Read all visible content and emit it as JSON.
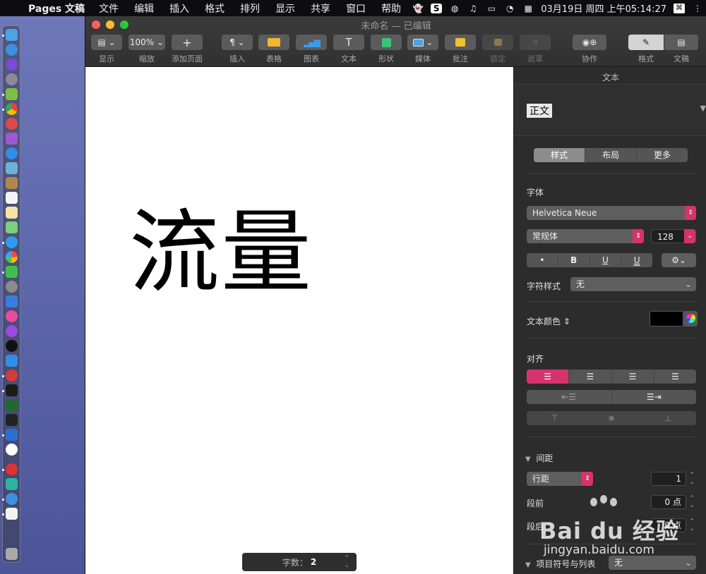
{
  "menubar": {
    "app_name": "Pages 文稿",
    "items": [
      "文件",
      "编辑",
      "插入",
      "格式",
      "排列",
      "显示",
      "共享",
      "窗口",
      "帮助"
    ],
    "datetime": "03月19日 周四 上午05:14:27"
  },
  "window": {
    "title": "未命名 — 已编辑"
  },
  "toolbar": {
    "view_label": "显示",
    "zoom_value": "100%",
    "zoom_label": "缩放",
    "add_page_label": "添加页面",
    "insert_label": "插入",
    "table_label": "表格",
    "chart_label": "图表",
    "text_label": "文本",
    "shape_label": "形状",
    "media_label": "媒体",
    "comment_label": "批注",
    "lock_label": "锁定",
    "mask_label": "遮罩",
    "collaborate_label": "协作",
    "format_label": "格式",
    "document_label": "文稿"
  },
  "document": {
    "body_text": "流量",
    "word_count_label": "字数：",
    "word_count": "2"
  },
  "inspector": {
    "header": "文本",
    "paragraph_style": "正文",
    "tabs": [
      "样式",
      "布局",
      "更多"
    ],
    "font_section": "字体",
    "font_family": "Helvetica Neue",
    "font_typeface": "常规体",
    "font_size": "128",
    "char_style_label": "字符样式",
    "char_style_value": "无",
    "text_color_label": "文本颜色",
    "text_color": "#000000",
    "align_section": "对齐",
    "spacing_section": "间距",
    "line_spacing_type": "行距",
    "line_spacing_value": "1",
    "before_para_label": "段前",
    "before_para_value": "0 点",
    "after_para_label": "段后",
    "after_para_value": "0 点",
    "bullets_label": "项目符号与列表",
    "bullets_value": "无"
  },
  "watermark": {
    "brand": "Bai du 经验",
    "url": "jingyan.baidu.com"
  },
  "colors": {
    "accent": "#d6336c",
    "toolbar_bg": "#3a3a3a",
    "inspector_bg": "#2c2c2c"
  }
}
